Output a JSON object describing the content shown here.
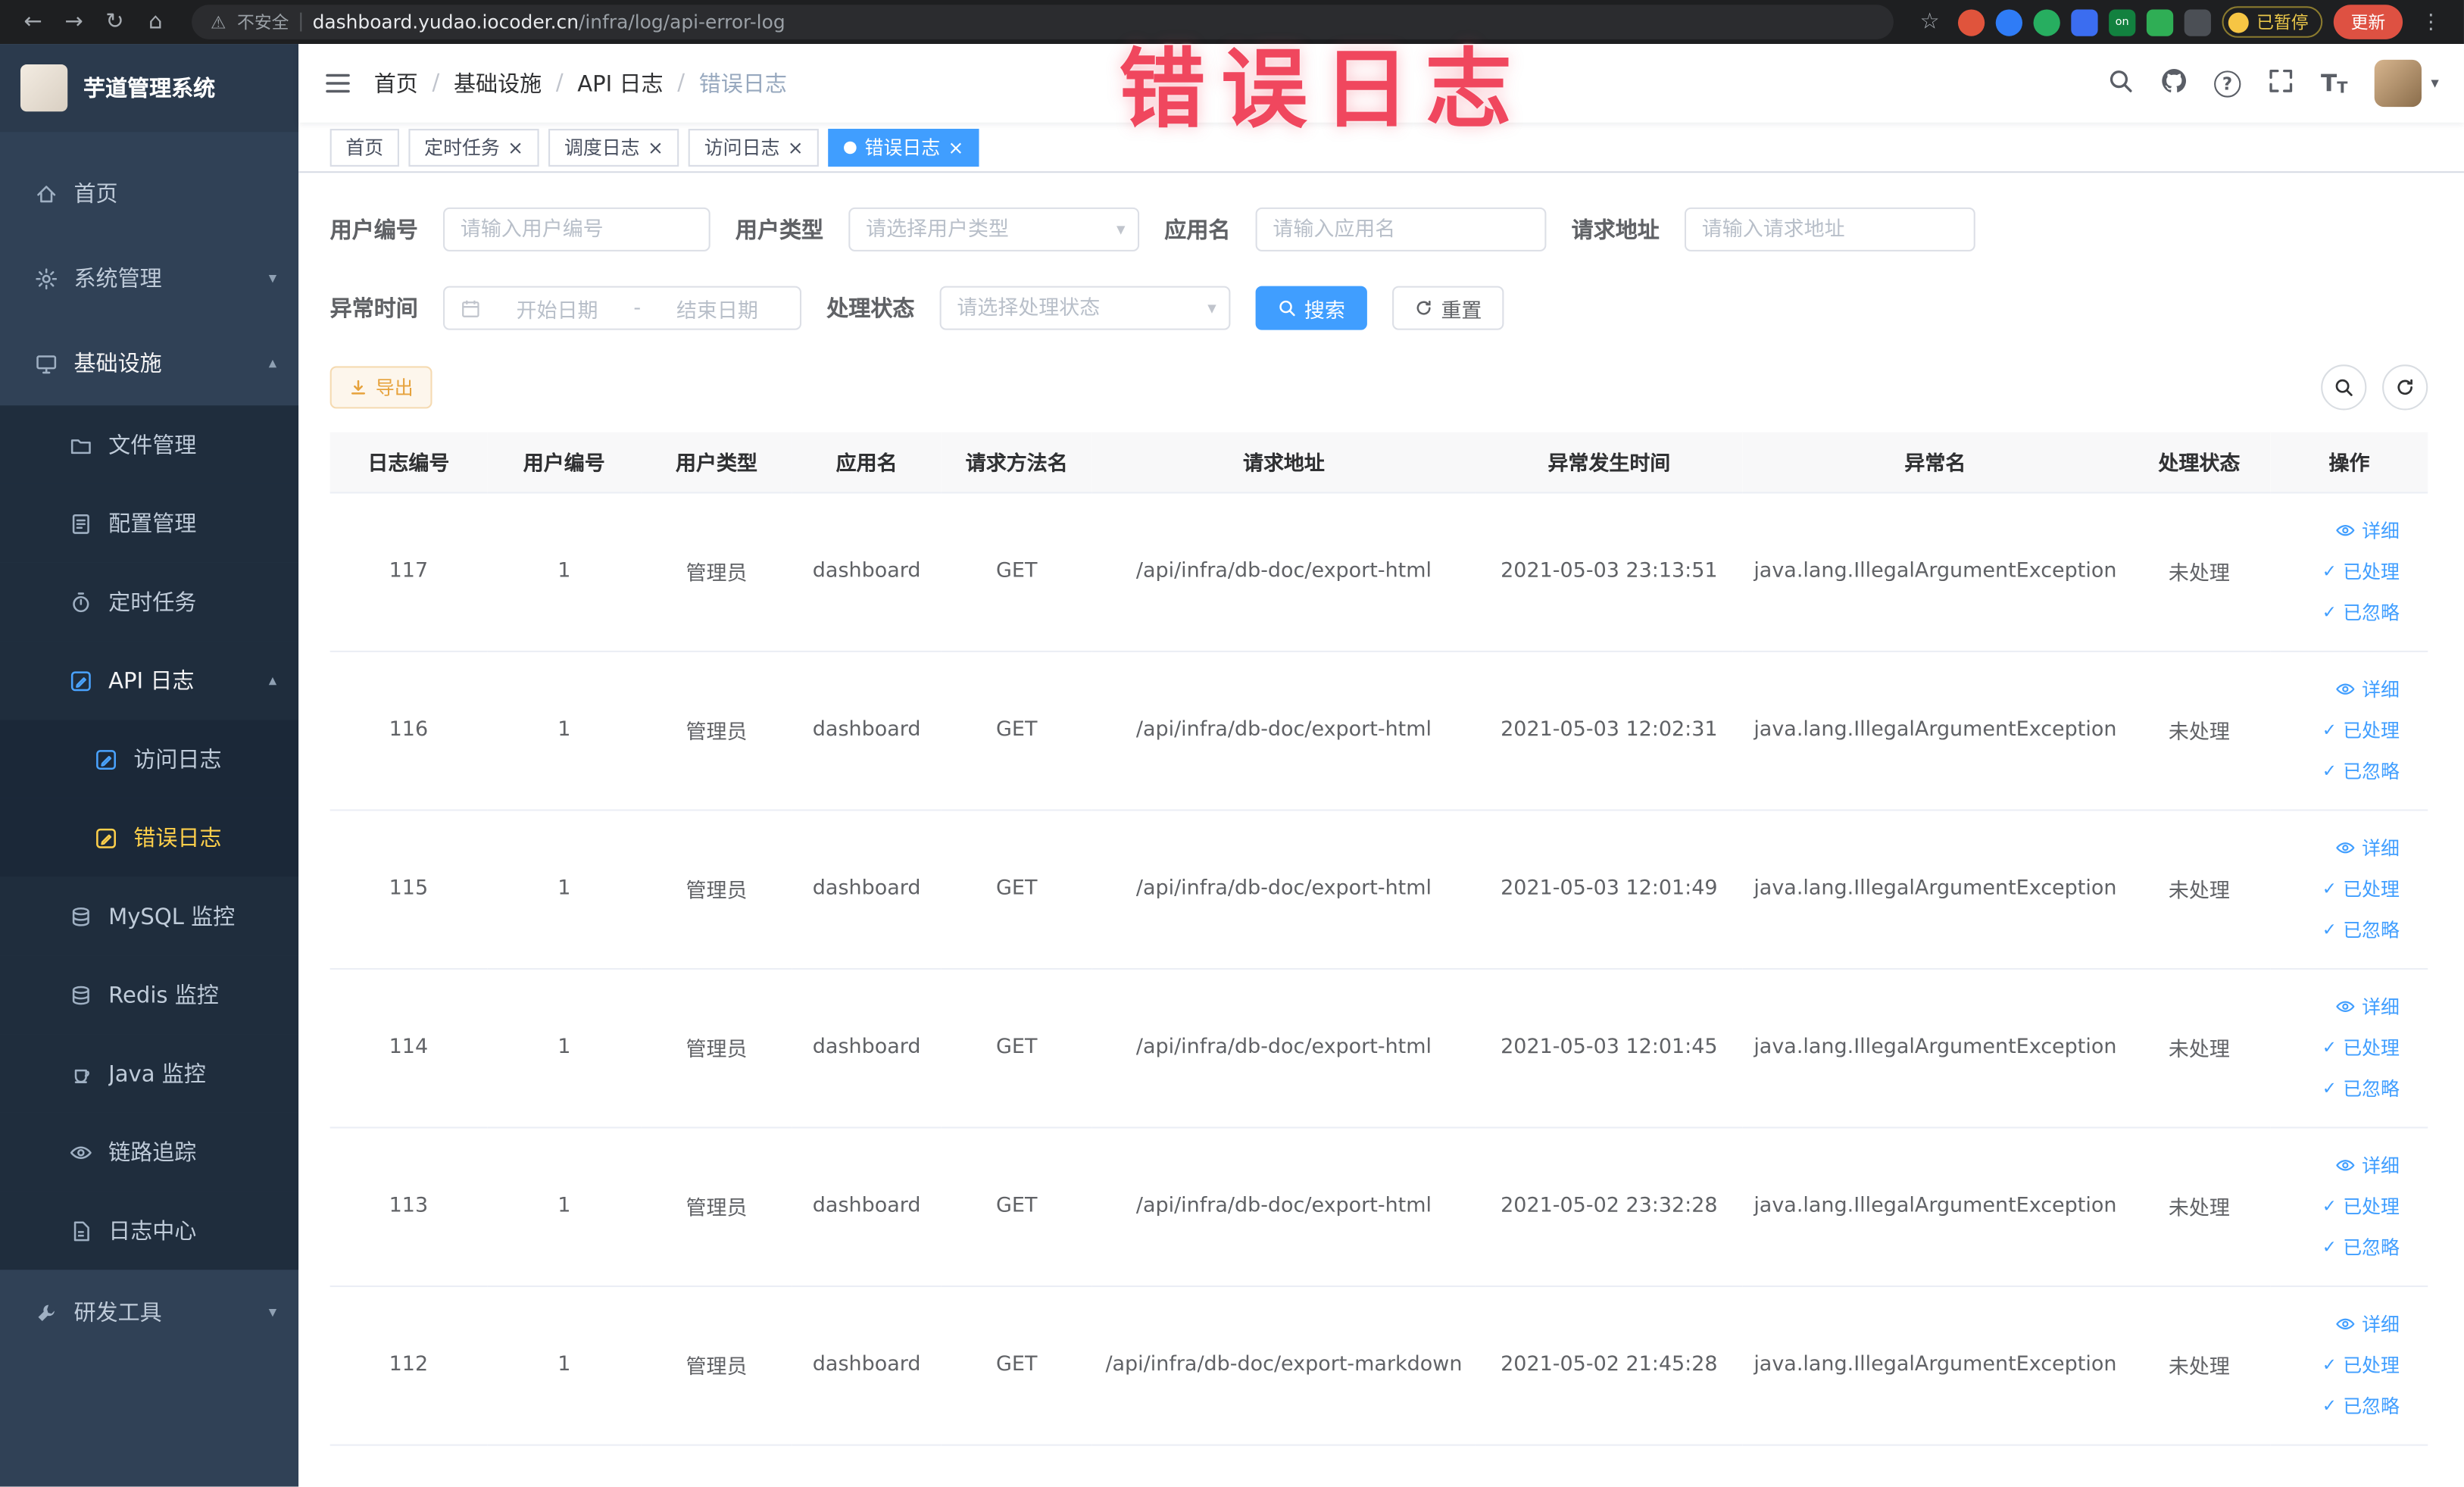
{
  "colors": {
    "accent": "#409eff",
    "sidebar_bg": "#304156",
    "submenu_bg": "#1f2d3d",
    "active_menu_text": "#ffd04b",
    "annotation_red": "#f0475e",
    "warning_button": "#e6a23c",
    "update_button_bg": "#de5142"
  },
  "icons": {
    "back": "←",
    "forward": "→",
    "reload": "↻",
    "home": "⌂",
    "warning": "⚠",
    "star": "☆",
    "menu": "⋮",
    "caret_down": "▾",
    "chevron_down": "▾",
    "chevron_up": "▴",
    "close": "×",
    "check": "✓"
  },
  "browser": {
    "security_label": "不安全",
    "url_host": "dashboard.yudao.iocoder.cn",
    "url_path": "/infra/log/api-error-log",
    "ext_on_label": "on",
    "paused_label": "已暂停",
    "update_label": "更新"
  },
  "annotation": {
    "text": "错误日志"
  },
  "sidebar": {
    "logo_title": "芋道管理系统",
    "items": [
      {
        "label": "首页"
      },
      {
        "label": "系统管理"
      },
      {
        "label": "基础设施"
      },
      {
        "label": "文件管理"
      },
      {
        "label": "配置管理"
      },
      {
        "label": "定时任务"
      },
      {
        "label": "API 日志"
      },
      {
        "label": "访问日志"
      },
      {
        "label": "错误日志"
      },
      {
        "label": "MySQL 监控"
      },
      {
        "label": "Redis 监控"
      },
      {
        "label": "Java 监控"
      },
      {
        "label": "链路追踪"
      },
      {
        "label": "日志中心"
      },
      {
        "label": "研发工具"
      }
    ]
  },
  "header": {
    "breadcrumb": [
      "首页",
      "基础设施",
      "API 日志",
      "错误日志"
    ]
  },
  "tabs": [
    {
      "label": "首页",
      "closable": false,
      "active": false
    },
    {
      "label": "定时任务",
      "closable": true,
      "active": false
    },
    {
      "label": "调度日志",
      "closable": true,
      "active": false
    },
    {
      "label": "访问日志",
      "closable": true,
      "active": false
    },
    {
      "label": "错误日志",
      "closable": true,
      "active": true
    }
  ],
  "filters": {
    "user_id": {
      "label": "用户编号",
      "placeholder": "请输入用户编号"
    },
    "user_type": {
      "label": "用户类型",
      "placeholder": "请选择用户类型"
    },
    "app_name": {
      "label": "应用名",
      "placeholder": "请输入应用名"
    },
    "request_url": {
      "label": "请求地址",
      "placeholder": "请输入请求地址"
    },
    "exception_time": {
      "label": "异常时间",
      "start_placeholder": "开始日期",
      "separator": "-",
      "end_placeholder": "结束日期"
    },
    "process_status": {
      "label": "处理状态",
      "placeholder": "请选择处理状态"
    },
    "search_label": "搜索",
    "reset_label": "重置"
  },
  "toolbar": {
    "export_label": "导出"
  },
  "table": {
    "columns": [
      "日志编号",
      "用户编号",
      "用户类型",
      "应用名",
      "请求方法名",
      "请求地址",
      "异常发生时间",
      "异常名",
      "处理状态",
      "操作"
    ],
    "actions": {
      "detail": "详细",
      "processed": "已处理",
      "ignored": "已忽略"
    },
    "rows": [
      {
        "log_id": "117",
        "user_id": "1",
        "user_type": "管理员",
        "app_name": "dashboard",
        "method": "GET",
        "url": "/api/infra/db-doc/export-html",
        "time": "2021-05-03 23:13:51",
        "exception": "java.lang.IllegalArgumentException",
        "status": "未处理"
      },
      {
        "log_id": "116",
        "user_id": "1",
        "user_type": "管理员",
        "app_name": "dashboard",
        "method": "GET",
        "url": "/api/infra/db-doc/export-html",
        "time": "2021-05-03 12:02:31",
        "exception": "java.lang.IllegalArgumentException",
        "status": "未处理"
      },
      {
        "log_id": "115",
        "user_id": "1",
        "user_type": "管理员",
        "app_name": "dashboard",
        "method": "GET",
        "url": "/api/infra/db-doc/export-html",
        "time": "2021-05-03 12:01:49",
        "exception": "java.lang.IllegalArgumentException",
        "status": "未处理"
      },
      {
        "log_id": "114",
        "user_id": "1",
        "user_type": "管理员",
        "app_name": "dashboard",
        "method": "GET",
        "url": "/api/infra/db-doc/export-html",
        "time": "2021-05-03 12:01:45",
        "exception": "java.lang.IllegalArgumentException",
        "status": "未处理"
      },
      {
        "log_id": "113",
        "user_id": "1",
        "user_type": "管理员",
        "app_name": "dashboard",
        "method": "GET",
        "url": "/api/infra/db-doc/export-html",
        "time": "2021-05-02 23:32:28",
        "exception": "java.lang.IllegalArgumentException",
        "status": "未处理"
      },
      {
        "log_id": "112",
        "user_id": "1",
        "user_type": "管理员",
        "app_name": "dashboard",
        "method": "GET",
        "url": "/api/infra/db-doc/export-markdown",
        "time": "2021-05-02 21:45:28",
        "exception": "java.lang.IllegalArgumentException",
        "status": "未处理"
      }
    ]
  }
}
